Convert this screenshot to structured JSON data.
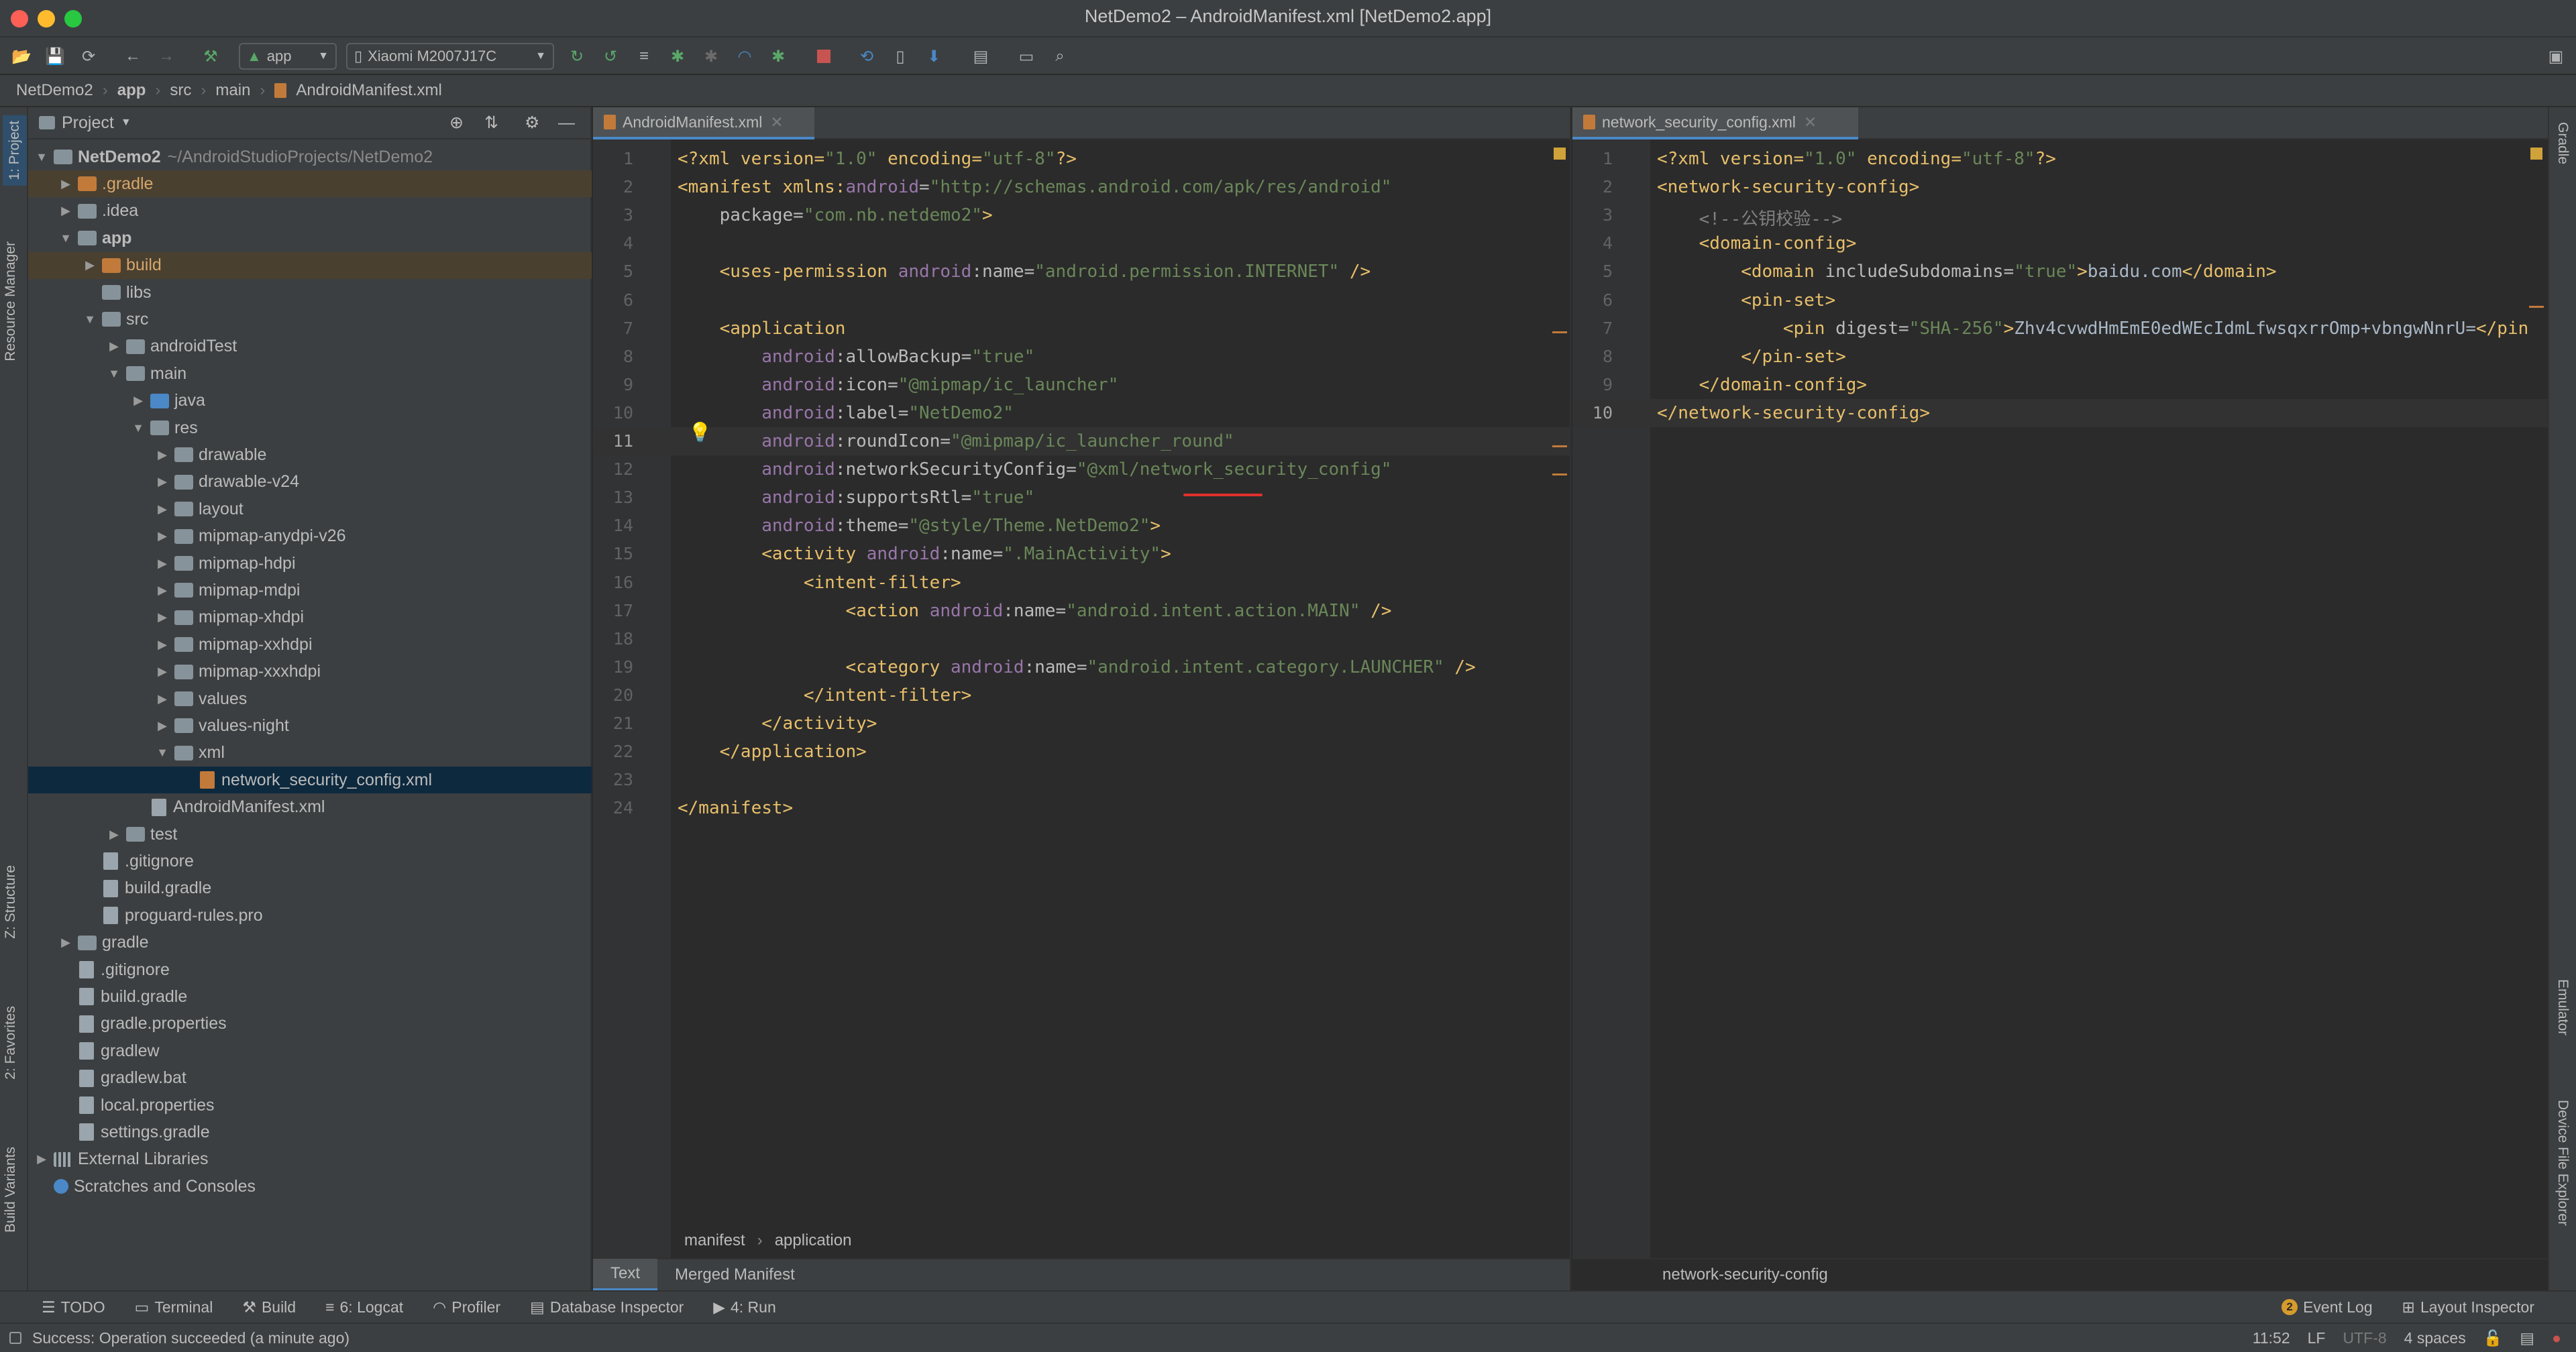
{
  "window": {
    "title": "NetDemo2 – AndroidManifest.xml [NetDemo2.app]"
  },
  "colors": {
    "accent": "#4a88c7",
    "close": "#fe5f57",
    "minimize": "#febb2e",
    "maximize": "#28c840",
    "selection": "#0d293e"
  },
  "toolbar": {
    "run_config": "app",
    "device": "Xiaomi M2007J17C",
    "icons": [
      "open-folder-icon",
      "save-icon",
      "sync-icon",
      "back-icon",
      "forward-icon",
      "hammer-icon",
      "run-icon",
      "apply-changes-icon",
      "apply-code-changes-icon",
      "debug-icon",
      "attach-debugger-icon",
      "profile-icon",
      "run-tests-icon",
      "stop-icon",
      "sync-gradle-icon",
      "device-manager-icon",
      "sdk-manager-icon",
      "project-structure-icon",
      "terminal-icon",
      "search-icon"
    ]
  },
  "breadcrumb": [
    "NetDemo2",
    "app",
    "src",
    "main",
    "AndroidManifest.xml"
  ],
  "left_strip": {
    "project": "1: Project",
    "resource_manager": "Resource Manager",
    "structure": "Z: Structure",
    "favorites": "2: Favorites",
    "build_variants": "Build Variants"
  },
  "right_strip": {
    "gradle": "Gradle",
    "emulator": "Emulator",
    "device_file_explorer": "Device File Explorer"
  },
  "project_panel": {
    "title": "Project",
    "tree": [
      {
        "label": "NetDemo2",
        "suffix": "~/AndroidStudioProjects/NetDemo2",
        "depth": 0,
        "arrow": "▼",
        "kind": "folder",
        "bold": true
      },
      {
        "label": ".gradle",
        "depth": 1,
        "arrow": "▶",
        "kind": "folder-orange",
        "hl": true
      },
      {
        "label": ".idea",
        "depth": 1,
        "arrow": "▶",
        "kind": "folder"
      },
      {
        "label": "app",
        "depth": 1,
        "arrow": "▼",
        "kind": "folder",
        "bold": true
      },
      {
        "label": "build",
        "depth": 2,
        "arrow": "▶",
        "kind": "folder-orange",
        "hl": true
      },
      {
        "label": "libs",
        "depth": 2,
        "arrow": "",
        "kind": "folder"
      },
      {
        "label": "src",
        "depth": 2,
        "arrow": "▼",
        "kind": "folder"
      },
      {
        "label": "androidTest",
        "depth": 3,
        "arrow": "▶",
        "kind": "folder"
      },
      {
        "label": "main",
        "depth": 3,
        "arrow": "▼",
        "kind": "folder"
      },
      {
        "label": "java",
        "depth": 4,
        "arrow": "▶",
        "kind": "folder-blue"
      },
      {
        "label": "res",
        "depth": 4,
        "arrow": "▼",
        "kind": "folder"
      },
      {
        "label": "drawable",
        "depth": 5,
        "arrow": "▶",
        "kind": "folder"
      },
      {
        "label": "drawable-v24",
        "depth": 5,
        "arrow": "▶",
        "kind": "folder"
      },
      {
        "label": "layout",
        "depth": 5,
        "arrow": "▶",
        "kind": "folder"
      },
      {
        "label": "mipmap-anydpi-v26",
        "depth": 5,
        "arrow": "▶",
        "kind": "folder"
      },
      {
        "label": "mipmap-hdpi",
        "depth": 5,
        "arrow": "▶",
        "kind": "folder"
      },
      {
        "label": "mipmap-mdpi",
        "depth": 5,
        "arrow": "▶",
        "kind": "folder"
      },
      {
        "label": "mipmap-xhdpi",
        "depth": 5,
        "arrow": "▶",
        "kind": "folder"
      },
      {
        "label": "mipmap-xxhdpi",
        "depth": 5,
        "arrow": "▶",
        "kind": "folder"
      },
      {
        "label": "mipmap-xxxhdpi",
        "depth": 5,
        "arrow": "▶",
        "kind": "folder"
      },
      {
        "label": "values",
        "depth": 5,
        "arrow": "▶",
        "kind": "folder"
      },
      {
        "label": "values-night",
        "depth": 5,
        "arrow": "▶",
        "kind": "folder"
      },
      {
        "label": "xml",
        "depth": 5,
        "arrow": "▼",
        "kind": "folder"
      },
      {
        "label": "network_security_config.xml",
        "depth": 6,
        "arrow": "",
        "kind": "file-xml",
        "selected": true
      },
      {
        "label": "AndroidManifest.xml",
        "depth": 4,
        "arrow": "",
        "kind": "file"
      },
      {
        "label": "test",
        "depth": 3,
        "arrow": "▶",
        "kind": "folder"
      },
      {
        "label": ".gitignore",
        "depth": 2,
        "arrow": "",
        "kind": "file"
      },
      {
        "label": "build.gradle",
        "depth": 2,
        "arrow": "",
        "kind": "file"
      },
      {
        "label": "proguard-rules.pro",
        "depth": 2,
        "arrow": "",
        "kind": "file"
      },
      {
        "label": "gradle",
        "depth": 1,
        "arrow": "▶",
        "kind": "folder"
      },
      {
        "label": ".gitignore",
        "depth": 1,
        "arrow": "",
        "kind": "file"
      },
      {
        "label": "build.gradle",
        "depth": 1,
        "arrow": "",
        "kind": "file"
      },
      {
        "label": "gradle.properties",
        "depth": 1,
        "arrow": "",
        "kind": "file"
      },
      {
        "label": "gradlew",
        "depth": 1,
        "arrow": "",
        "kind": "file"
      },
      {
        "label": "gradlew.bat",
        "depth": 1,
        "arrow": "",
        "kind": "file"
      },
      {
        "label": "local.properties",
        "depth": 1,
        "arrow": "",
        "kind": "file"
      },
      {
        "label": "settings.gradle",
        "depth": 1,
        "arrow": "",
        "kind": "file"
      },
      {
        "label": "External Libraries",
        "depth": 0,
        "arrow": "▶",
        "kind": "lib"
      },
      {
        "label": "Scratches and Consoles",
        "depth": 0,
        "arrow": "",
        "kind": "scratch"
      }
    ]
  },
  "editor_left": {
    "tab": "AndroidManifest.xml",
    "current_line": 11,
    "lines": [
      [
        [
          "t",
          "<?xml version="
        ],
        [
          "s",
          "\"1.0\""
        ],
        [
          "t",
          " encoding="
        ],
        [
          "s",
          "\"utf-8\""
        ],
        [
          "t",
          "?>"
        ]
      ],
      [
        [
          "t",
          "<manifest xmlns:"
        ],
        [
          "ns",
          "android"
        ],
        [
          "a",
          "="
        ],
        [
          "s",
          "\"http://schemas.android.com/apk/res/android\""
        ]
      ],
      [
        [
          "a",
          "    package="
        ],
        [
          "s",
          "\"com.nb.netdemo2\""
        ],
        [
          "t",
          ">"
        ]
      ],
      [],
      [
        [
          "t",
          "    <uses-permission "
        ],
        [
          "ns",
          "android"
        ],
        [
          "a",
          ":name="
        ],
        [
          "s",
          "\"android.permission.INTERNET\""
        ],
        [
          "t",
          " />"
        ]
      ],
      [],
      [
        [
          "t",
          "    <application"
        ]
      ],
      [
        [
          "ns",
          "        android"
        ],
        [
          "a",
          ":allowBackup="
        ],
        [
          "s",
          "\"true\""
        ]
      ],
      [
        [
          "ns",
          "        android"
        ],
        [
          "a",
          ":icon="
        ],
        [
          "s",
          "\"@mipmap/ic_launcher\""
        ]
      ],
      [
        [
          "ns",
          "        android"
        ],
        [
          "a",
          ":label="
        ],
        [
          "s",
          "\"NetDemo2\""
        ]
      ],
      [
        [
          "ns",
          "        android"
        ],
        [
          "a",
          ":roundIcon="
        ],
        [
          "s",
          "\"@mipmap/ic_launcher_round\""
        ]
      ],
      [
        [
          "ns",
          "        android"
        ],
        [
          "a",
          ":networkSecurityConfig="
        ],
        [
          "s",
          "\"@xml/network_security_config\""
        ]
      ],
      [
        [
          "ns",
          "        android"
        ],
        [
          "a",
          ":supportsRtl="
        ],
        [
          "s",
          "\"true\""
        ]
      ],
      [
        [
          "ns",
          "        android"
        ],
        [
          "a",
          ":theme="
        ],
        [
          "s",
          "\"@style/Theme.NetDemo2\""
        ],
        [
          "t",
          ">"
        ]
      ],
      [
        [
          "t",
          "        <activity "
        ],
        [
          "ns",
          "android"
        ],
        [
          "a",
          ":name="
        ],
        [
          "s",
          "\".MainActivity\""
        ],
        [
          "t",
          ">"
        ]
      ],
      [
        [
          "t",
          "            <intent-filter>"
        ]
      ],
      [
        [
          "t",
          "                <action "
        ],
        [
          "ns",
          "android"
        ],
        [
          "a",
          ":name="
        ],
        [
          "s",
          "\"android.intent.action.MAIN\""
        ],
        [
          "t",
          " />"
        ]
      ],
      [],
      [
        [
          "t",
          "                <category "
        ],
        [
          "ns",
          "android"
        ],
        [
          "a",
          ":name="
        ],
        [
          "s",
          "\"android.intent.category.LAUNCHER\""
        ],
        [
          "t",
          " />"
        ]
      ],
      [
        [
          "t",
          "            </intent-filter>"
        ]
      ],
      [
        [
          "t",
          "        </activity>"
        ]
      ],
      [
        [
          "t",
          "    </application>"
        ]
      ],
      [],
      [
        [
          "t",
          "</manifest>"
        ]
      ]
    ],
    "footer_crumbs": [
      "manifest",
      "application"
    ],
    "bottom_tabs": [
      "Text",
      "Merged Manifest"
    ]
  },
  "editor_right": {
    "tab": "network_security_config.xml",
    "current_line": 10,
    "lines": [
      [
        [
          "t",
          "<?xml version="
        ],
        [
          "s",
          "\"1.0\""
        ],
        [
          "t",
          " encoding="
        ],
        [
          "s",
          "\"utf-8\""
        ],
        [
          "t",
          "?>"
        ]
      ],
      [
        [
          "t",
          "<network-security-config>"
        ]
      ],
      [
        [
          "c",
          "    <!--公钥校验-->"
        ]
      ],
      [
        [
          "t",
          "    <domain-config>"
        ]
      ],
      [
        [
          "t",
          "        <domain "
        ],
        [
          "a",
          "includeSubdomains="
        ],
        [
          "s",
          "\"true\""
        ],
        [
          "t",
          ">"
        ],
        [
          "p",
          "baidu.com"
        ],
        [
          "t",
          "</domain>"
        ]
      ],
      [
        [
          "t",
          "        <pin-set>"
        ]
      ],
      [
        [
          "t",
          "            <pin "
        ],
        [
          "a",
          "digest="
        ],
        [
          "s",
          "\"SHA-256\""
        ],
        [
          "t",
          ">"
        ],
        [
          "p",
          "Zhv4cvwdHmEmE0edWEcIdmLfwsqxrrOmp+vbngwNnrU="
        ],
        [
          "t",
          "</pin"
        ]
      ],
      [
        [
          "t",
          "        </pin-set>"
        ]
      ],
      [
        [
          "t",
          "    </domain-config>"
        ]
      ],
      [
        [
          "t",
          "</network-security-config>"
        ]
      ]
    ],
    "footer_crumb": "network-security-config"
  },
  "bottom_tool_tabs": [
    {
      "label": "TODO",
      "icon": "list-icon"
    },
    {
      "label": "Terminal",
      "icon": "terminal-icon"
    },
    {
      "label": "Build",
      "icon": "hammer-icon"
    },
    {
      "label": "6: Logcat",
      "icon": "logcat-icon"
    },
    {
      "label": "Profiler",
      "icon": "profiler-icon"
    },
    {
      "label": "Database Inspector",
      "icon": "database-icon"
    },
    {
      "label": "4: Run",
      "icon": "run-icon"
    }
  ],
  "right_tool_tabs": [
    {
      "label": "Event Log",
      "icon": "event-log-icon",
      "badge": "2"
    },
    {
      "label": "Layout Inspector",
      "icon": "layout-inspector-icon"
    }
  ],
  "status": {
    "message": "Success: Operation succeeded (a minute ago)",
    "position": "11:52",
    "line_sep": "LF",
    "encoding": "UTF-8",
    "indent": "4 spaces"
  }
}
